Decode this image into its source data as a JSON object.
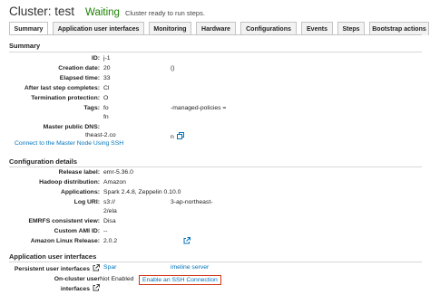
{
  "header": {
    "title": "Cluster: test",
    "status": "Waiting",
    "status_description": "Cluster ready to run steps."
  },
  "tabs": [
    {
      "label": "Summary",
      "active": true
    },
    {
      "label": "Application user interfaces",
      "active": false
    },
    {
      "label": "Monitoring",
      "active": false
    },
    {
      "label": "Hardware",
      "active": false
    },
    {
      "label": "Configurations",
      "active": false
    },
    {
      "label": "Events",
      "active": false
    },
    {
      "label": "Steps",
      "active": false
    },
    {
      "label": "Bootstrap actions",
      "active": false
    }
  ],
  "summary": {
    "title": "Summary",
    "id": {
      "label": "ID:",
      "value": "j-1"
    },
    "creation_date": {
      "label": "Creation date:",
      "value": "20",
      "value_right": "()"
    },
    "elapsed_time": {
      "label": "Elapsed time:",
      "value": "33"
    },
    "after_last_step": {
      "label": "After last step completes:",
      "value": "Cl"
    },
    "termination_protection": {
      "label": "Termination protection:",
      "value": "O"
    },
    "tags": {
      "label": "Tags:",
      "value": "fo",
      "value_right": "-managed-policies =",
      "value_line2": "fn"
    },
    "master_dns": {
      "label": "Master public DNS:",
      "value": "theast-2.co",
      "value_right": "n"
    },
    "connect_link": "Connect to the Master Node Using SSH"
  },
  "configuration": {
    "title": "Configuration details",
    "release_label": {
      "label": "Release label:",
      "value": "emr-5.36.0"
    },
    "hadoop_distribution": {
      "label": "Hadoop distribution:",
      "value": "Amazon"
    },
    "applications": {
      "label": "Applications:",
      "value": "Spark 2.4.8, Zeppelin 0.10.0"
    },
    "log_uri": {
      "label": "Log URI:",
      "value": "s3://",
      "value_right": "3-ap-northeast-",
      "value_line2": "2/ela"
    },
    "emrfs_consistent_view": {
      "label": "EMRFS consistent view:",
      "value": "Disa"
    },
    "custom_ami_id": {
      "label": "Custom AMI ID:",
      "value": "--"
    },
    "amazon_linux_release": {
      "label": "Amazon Linux Release:",
      "value": "2.0.2"
    }
  },
  "app_ui": {
    "title": "Application user interfaces",
    "persistent": {
      "label": "Persistent user interfaces",
      "value": "Spar",
      "value_right": "imeline server"
    },
    "on_cluster": {
      "label_line1": "On-cluster user",
      "label_line2": "interfaces",
      "value": "Not Enabled",
      "ssh_link": "Enable an SSH Connection"
    }
  },
  "colors": {
    "status_green": "#1d8102",
    "link_blue": "#0073bb",
    "highlight_red": "#d13212"
  }
}
